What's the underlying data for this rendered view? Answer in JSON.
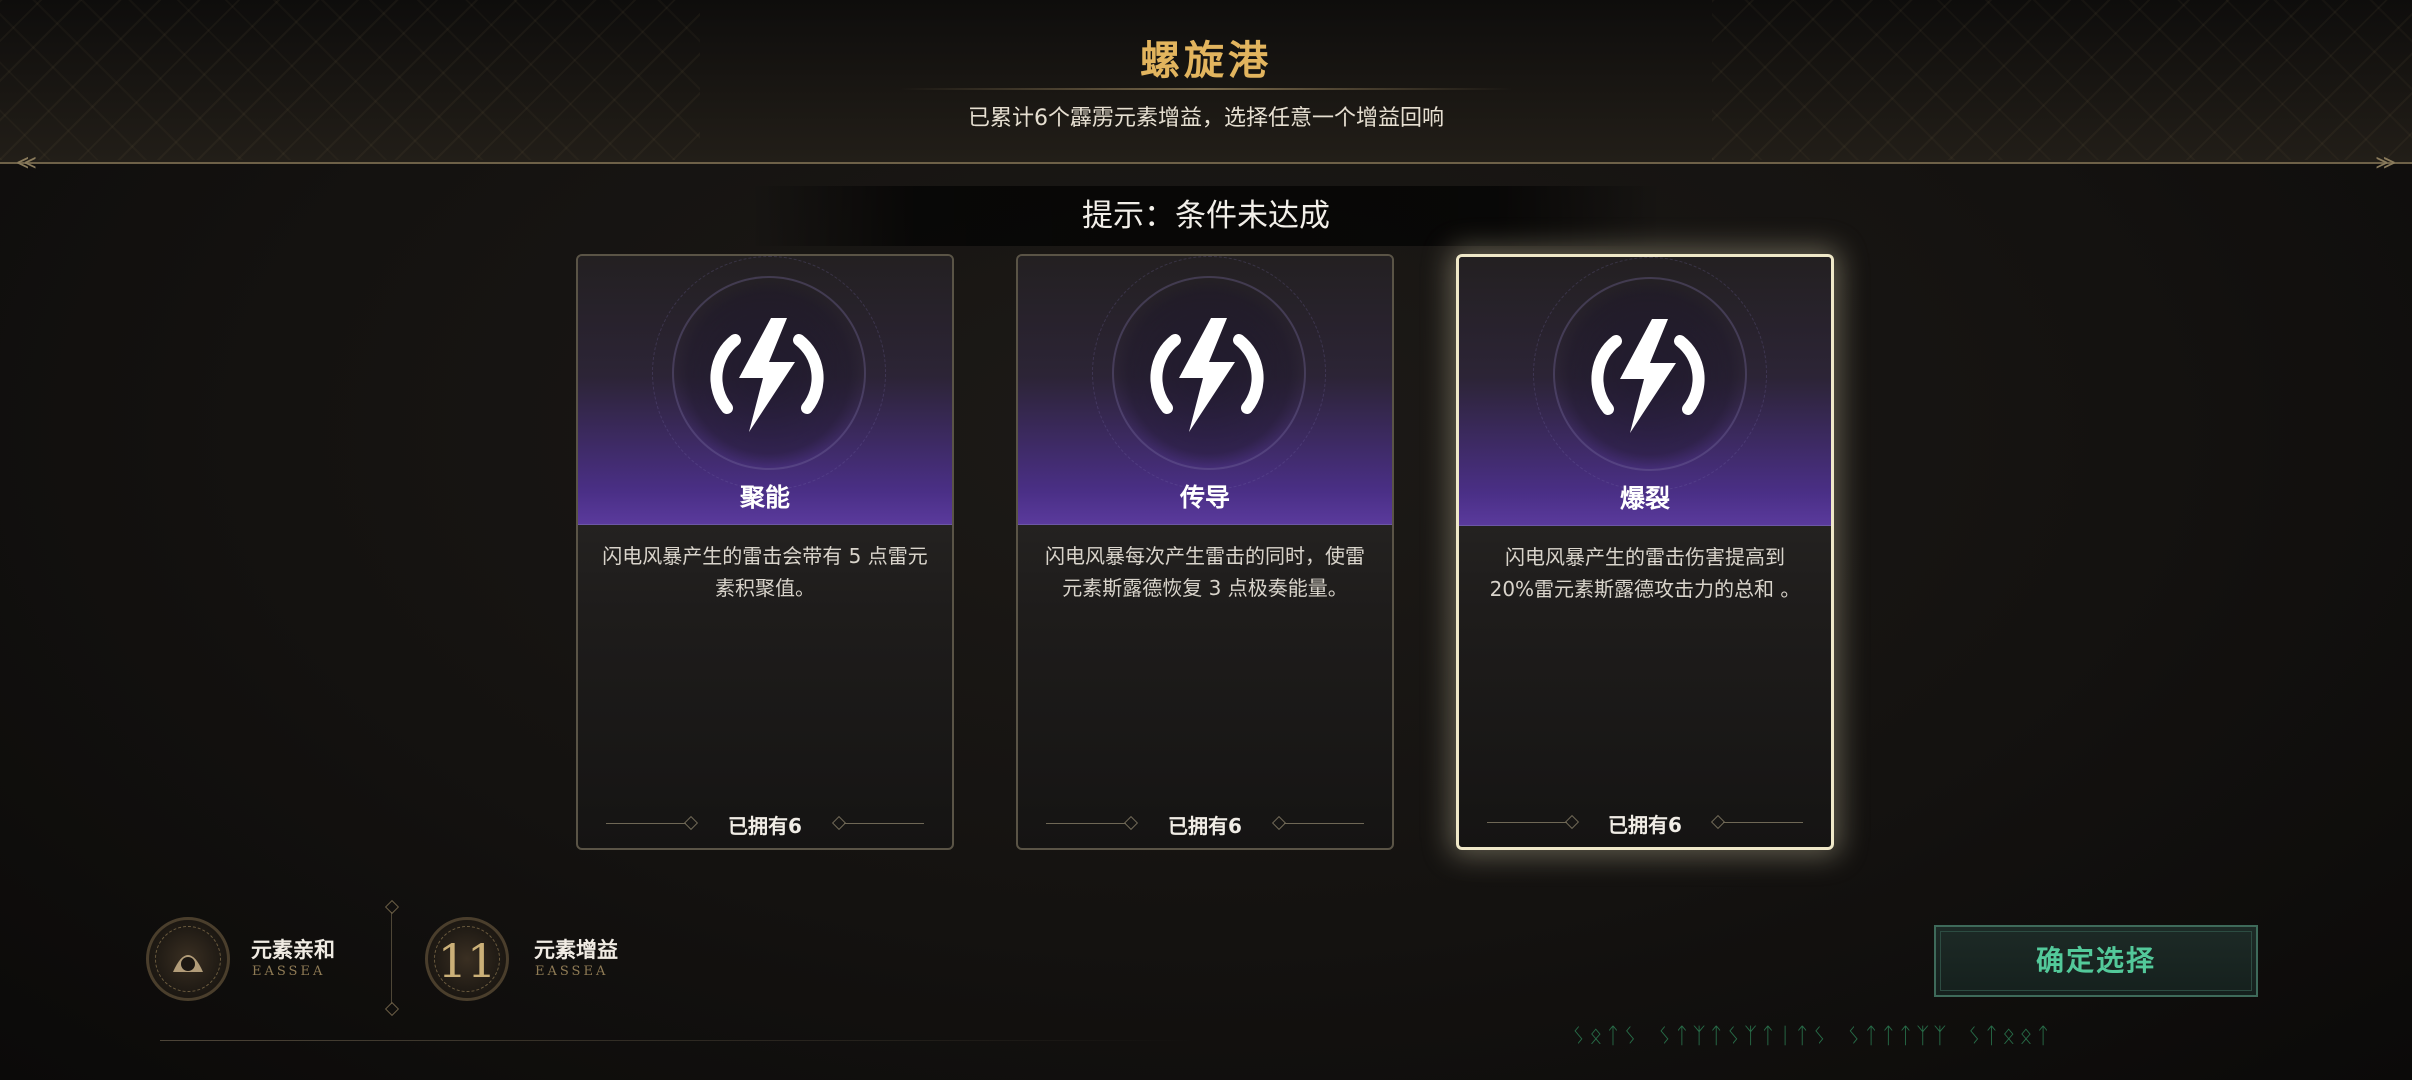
{
  "header": {
    "title": "螺旋港",
    "subtitle": "已累计6个霹雳元素增益，选择任意一个增益回响"
  },
  "hint": "提示：条件未达成",
  "cards": [
    {
      "name": "聚能",
      "icon": "lightning-emblem-icon",
      "desc": "闪电风暴产生的雷击会带有 5 点雷元素积聚值。",
      "owned": "已拥有6",
      "selected": false
    },
    {
      "name": "传导",
      "icon": "lightning-emblem-icon",
      "desc": "闪电风暴每次产生雷击的同时，使雷元素斯露德恢复 3 点极奏能量。",
      "owned": "已拥有6",
      "selected": false
    },
    {
      "name": "爆裂",
      "icon": "lightning-emblem-icon",
      "desc": "闪电风暴产生的雷击伤害提高到 20%雷元素斯露德攻击力的总和 。",
      "owned": "已拥有6",
      "selected": true
    }
  ],
  "status": {
    "affinity": {
      "label": "元素亲和",
      "sub": "EASSEA"
    },
    "buff": {
      "label": "元素增益",
      "sub": "EASSEA",
      "count": "11"
    }
  },
  "confirm_label": "确定选择",
  "rune_text": "ᛊᛟᛏᛊ ᛊᛏᛉᛏᛊᛉᛏᛁᛏᛊ ᛊᛏᛏᛏᛉᛉ ᛊᛏᛟᛟᛏ",
  "colors": {
    "title_gold": "#e2b45e",
    "card_purple": "#5a3a9c",
    "confirm_green": "#53c99a"
  }
}
